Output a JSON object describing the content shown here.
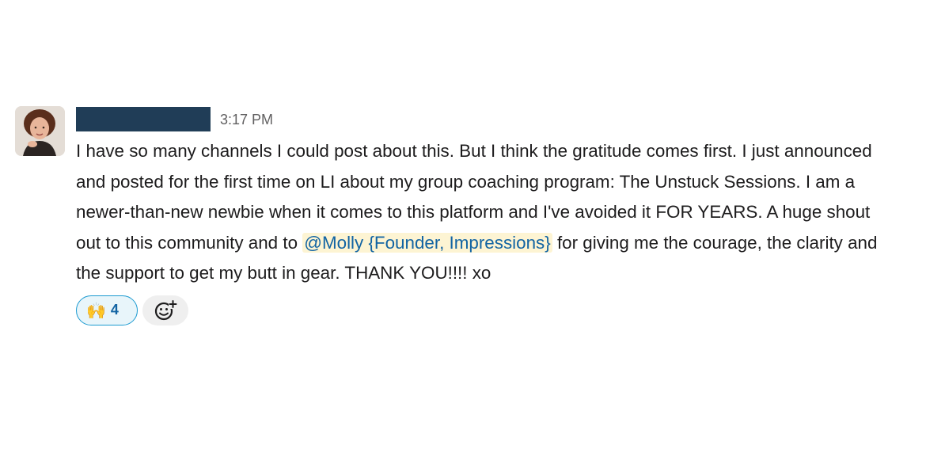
{
  "message": {
    "author_redacted": true,
    "timestamp": "3:17 PM",
    "text_before_mention": "I have so many channels I could post about this.  But I think the gratitude comes first. I just announced and posted for the first time on LI about my group coaching program: The Unstuck Sessions. I am a newer-than-new newbie when it comes to this platform and I've avoided it FOR YEARS.  A huge shout out to this community and to ",
    "mention": "@Molly {Founder, Impressions}",
    "text_after_mention": " for giving me the courage, the clarity and the support to get my butt in gear. THANK YOU!!!! xo"
  },
  "reactions": [
    {
      "emoji": "🙌",
      "icon": "raised-hands-emoji",
      "count": "4"
    }
  ],
  "add_reaction_icon": "add-reaction-icon",
  "colors": {
    "redacted_bar": "#203d57",
    "mention_text": "#1264a3",
    "mention_bg": "#fdf4d3",
    "reaction_border": "#1d9bd1",
    "reaction_bg": "#e8f5fa"
  }
}
